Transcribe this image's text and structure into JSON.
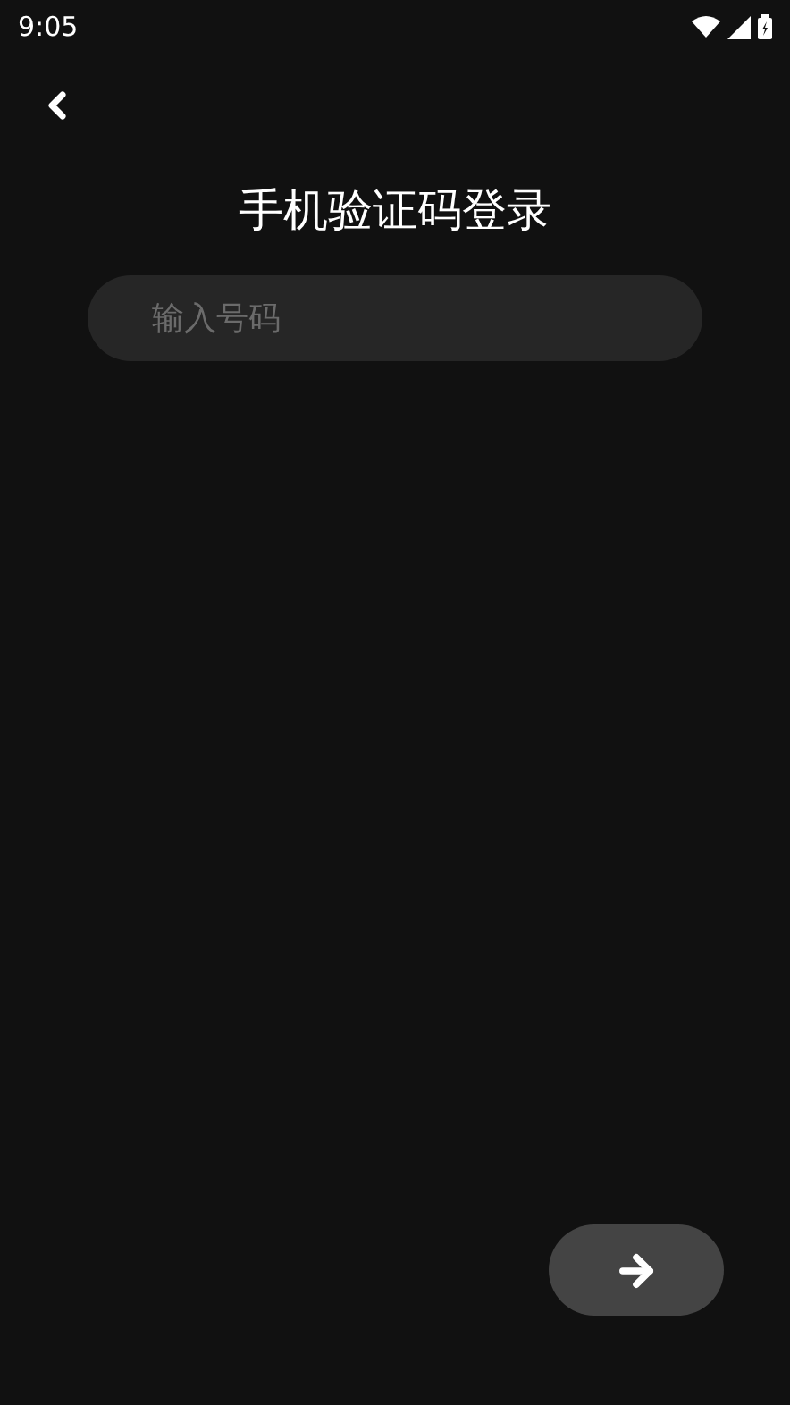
{
  "status_bar": {
    "time": "9:05"
  },
  "title": "手机验证码登录",
  "phone_field": {
    "placeholder": "输入号码"
  }
}
